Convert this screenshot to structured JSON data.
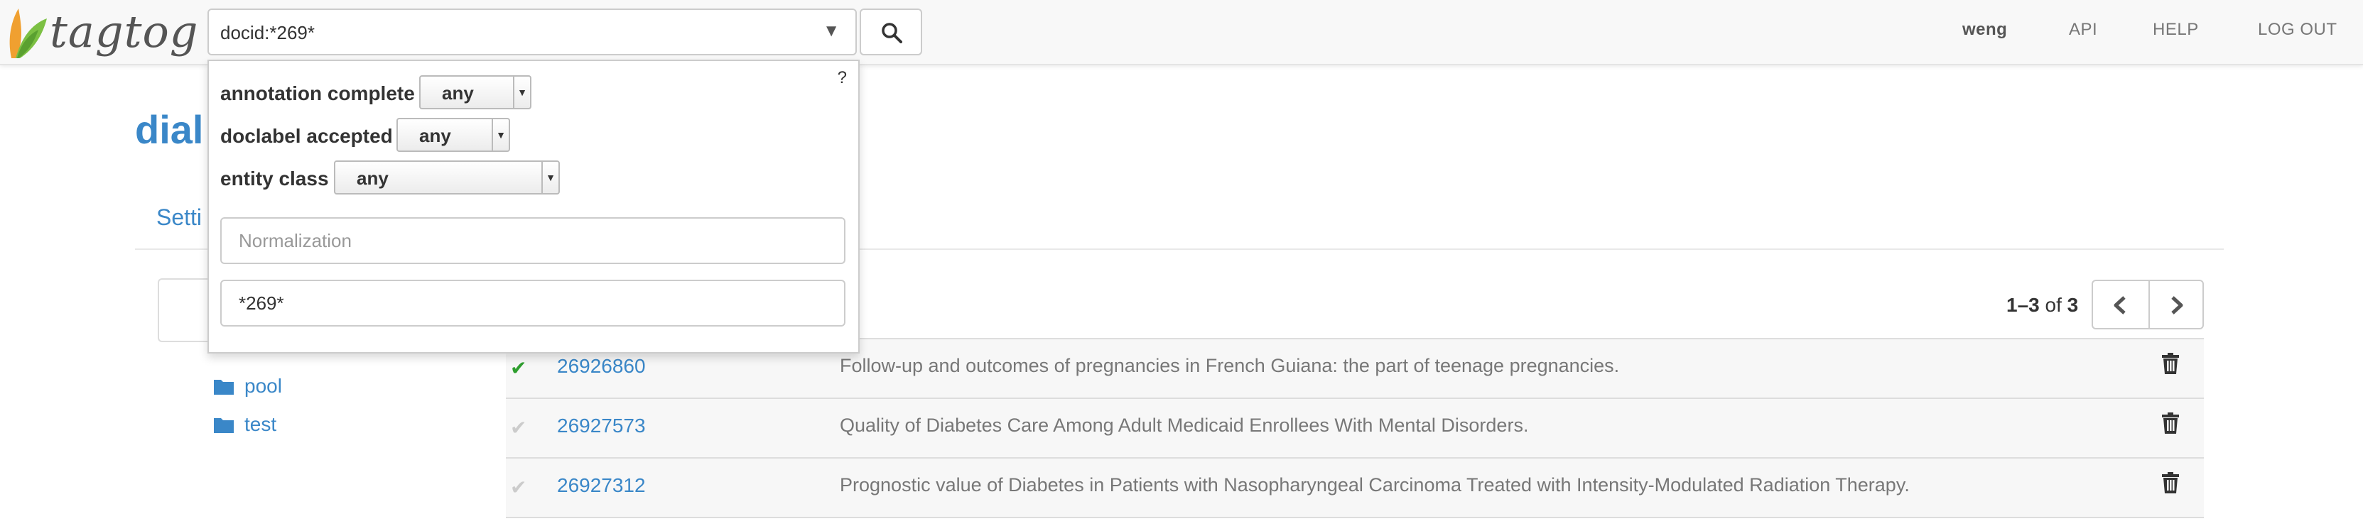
{
  "brand": {
    "name": "tagtog"
  },
  "search": {
    "value": "docid:*269*"
  },
  "nav": {
    "user": "weng",
    "api": "API",
    "help": "HELP",
    "logout": "LOG OUT"
  },
  "page": {
    "title": "dial",
    "tab_settings": "Setti"
  },
  "sidebar": {
    "folders": [
      "pool",
      "test"
    ]
  },
  "filters": {
    "help": "?",
    "annotation_complete": {
      "label": "annotation complete",
      "value": "any"
    },
    "doclabel_accepted": {
      "label": "doclabel accepted",
      "value": "any"
    },
    "entity_class": {
      "label": "entity class",
      "value": "any"
    },
    "normalization_placeholder": "Normalization",
    "docid_value": "*269*"
  },
  "pagination": {
    "range": "1–3",
    "of": "of",
    "total": "3"
  },
  "documents": [
    {
      "status": "complete",
      "id": "26926860",
      "title": "Follow-up and outcomes of pregnancies in French Guiana: the part of teenage pregnancies."
    },
    {
      "status": "incomplete",
      "id": "26927573",
      "title": "Quality of Diabetes Care Among Adult Medicaid Enrollees With Mental Disorders."
    },
    {
      "status": "incomplete",
      "id": "26927312",
      "title": "Prognostic value of Diabetes in Patients with Nasopharyngeal Carcinoma Treated with Intensity-Modulated Radiation Therapy."
    }
  ],
  "icons": {
    "logo": "leaf-logo-icon",
    "search": "magnifier-icon",
    "caret": "triangle-down-icon",
    "folder": "folder-icon",
    "check": "check-icon",
    "trash": "trash-icon",
    "prev": "chevron-left-icon",
    "next": "chevron-right-icon"
  },
  "colors": {
    "link": "#3a87c8",
    "check_complete": "#2e9e2e",
    "check_incomplete": "#cccccc",
    "leaf_orange": "#f0a030",
    "leaf_green": "#7cc043"
  }
}
